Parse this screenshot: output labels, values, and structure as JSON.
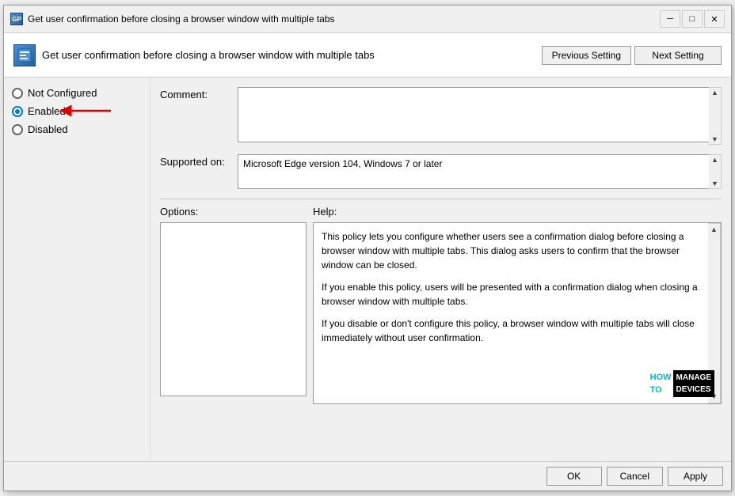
{
  "window": {
    "title": "Get user confirmation before closing a browser window with multiple tabs",
    "icon_label": "GP"
  },
  "title_bar": {
    "minimize": "─",
    "maximize": "□",
    "close": "✕"
  },
  "header": {
    "title": "Get user confirmation before closing a browser window with multiple tabs",
    "prev_button": "Previous Setting",
    "next_button": "Next Setting"
  },
  "radio_options": {
    "not_configured": "Not Configured",
    "enabled": "Enabled",
    "disabled": "Disabled",
    "selected": "enabled"
  },
  "fields": {
    "comment_label": "Comment:",
    "comment_value": "",
    "comment_placeholder": "",
    "supported_label": "Supported on:",
    "supported_value": "Microsoft Edge version 104, Windows 7 or later"
  },
  "sections": {
    "options_label": "Options:",
    "help_label": "Help:"
  },
  "help_text": {
    "paragraph1": "This policy lets you configure whether users see a confirmation dialog before closing a browser window with multiple tabs. This dialog asks users to confirm that the browser window can be closed.",
    "paragraph2": "If you enable this policy, users will be presented with a confirmation dialog when closing a browser window with multiple tabs.",
    "paragraph3": "If you disable or don't configure this policy, a browser window with multiple tabs will close immediately without user confirmation."
  },
  "watermark": {
    "how_to": "HOW TO",
    "manage": "MANAGE DEVICES"
  },
  "bottom_buttons": {
    "ok": "OK",
    "cancel": "Cancel",
    "apply": "Apply"
  }
}
